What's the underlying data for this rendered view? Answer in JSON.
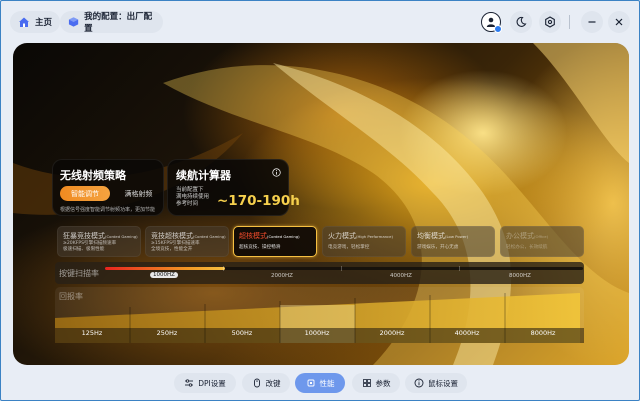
{
  "header": {
    "home_label": "主页",
    "config_label": "我的配置：出厂配置",
    "icons": [
      "home-icon",
      "cube-icon",
      "avatar-icon",
      "moon-icon",
      "settings-icon",
      "minimize-icon",
      "close-icon"
    ]
  },
  "rf_strategy": {
    "title": "无线射频策略",
    "active_option": "智能调节",
    "inactive_option": "满格射频",
    "note": "根据信号强度智能调节射频功率，更加节能"
  },
  "battery": {
    "title": "续航计算器",
    "note_line1": "当前配置下",
    "note_line2": "满电持续使用",
    "note_line3": "参考时间",
    "value": "~170-190h"
  },
  "modes": [
    {
      "title": "狂暴竞技模式",
      "sub": "(Corded Gaming)",
      "desc1": "≥20KFPS引擎扫描频速率",
      "desc2": "极速扫描、极限性能",
      "state": "normal"
    },
    {
      "title": "竞技超核模式",
      "sub": "(Corded Gaming)",
      "desc1": "≥15KFPS引擎扫描速率",
      "desc2": "全境竞技，性能全开",
      "state": "normal"
    },
    {
      "title": "超核模式",
      "sub": "(Corded Gaming)",
      "desc1": "超核竞技、操控畅滑",
      "desc2": "",
      "state": "active"
    },
    {
      "title": "火力模式",
      "sub": "(High Performance)",
      "desc1": "电竞游戏，轻松掌控",
      "desc2": "",
      "state": "normal"
    },
    {
      "title": "均衡模式",
      "sub": "(Low Power)",
      "desc1": "游戏娱乐，开心无虑",
      "desc2": "",
      "state": "normal"
    },
    {
      "title": "办公模式",
      "sub": "(Office)",
      "desc1": "轻松办公，长效续航",
      "desc2": "",
      "state": "dim"
    }
  ],
  "polling": {
    "label": "按键扫描率",
    "ticks": [
      "1000HZ",
      "2000HZ",
      "4000HZ",
      "8000HZ"
    ],
    "selected": "1000HZ",
    "fill_fraction": 0.25
  },
  "report_rate": {
    "label": "回报率",
    "options": [
      "125Hz",
      "250Hz",
      "500Hz",
      "1000Hz",
      "2000Hz",
      "4000Hz",
      "8000Hz"
    ],
    "selected": "1000Hz"
  },
  "nav": {
    "items": [
      {
        "label": "DPI设置",
        "icon": "sliders-icon"
      },
      {
        "label": "改键",
        "icon": "mouse-icon"
      },
      {
        "label": "性能",
        "icon": "chip-icon",
        "active": true
      },
      {
        "label": "参数",
        "icon": "grid-icon"
      },
      {
        "label": "鼠标设置",
        "icon": "info-icon"
      }
    ]
  }
}
